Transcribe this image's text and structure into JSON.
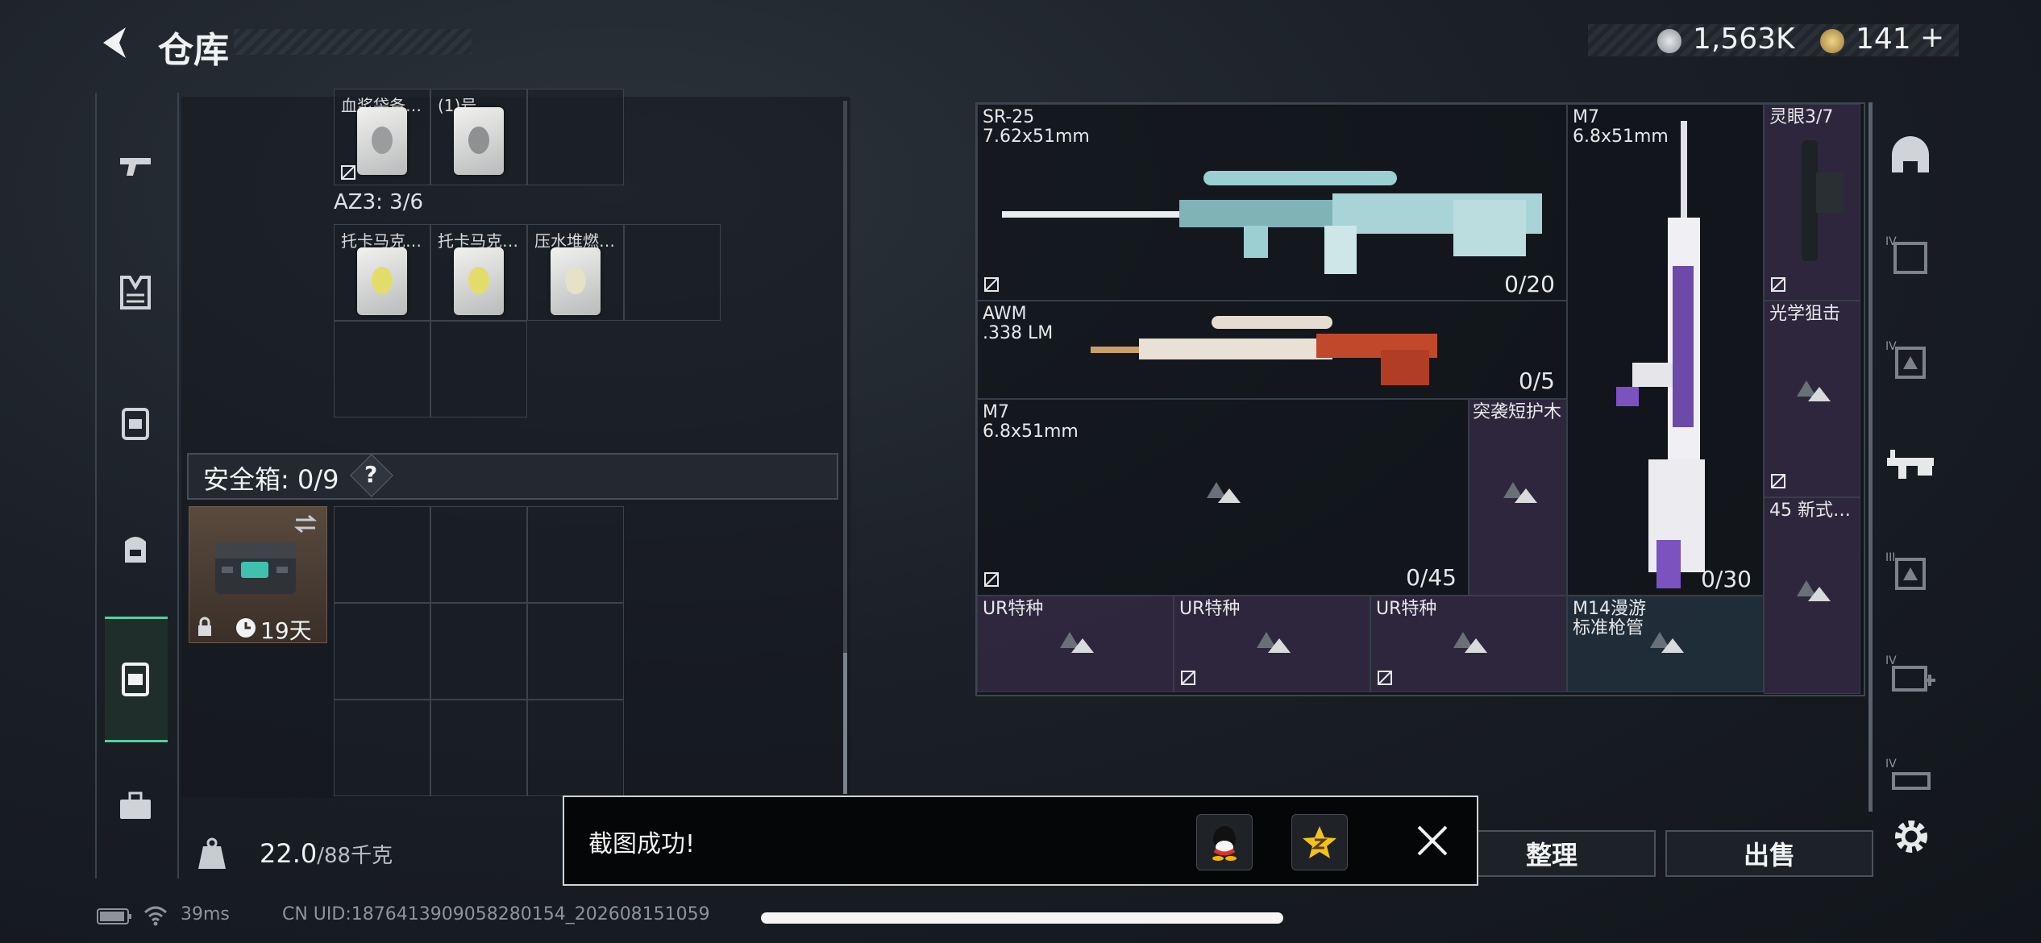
{
  "header": {
    "title": "仓库",
    "currency_primary": "1,563K",
    "currency_secondary": "141",
    "add_symbol": "+",
    "colors": {
      "accent": "#4fd1a4",
      "coin_silver": "#c8ccd0",
      "coin_gold": "#c9a85a"
    }
  },
  "sidebar": {
    "items": [
      {
        "name": "pistol-icon"
      },
      {
        "name": "armor-icon"
      },
      {
        "name": "chest-rig-icon"
      },
      {
        "name": "backpack-icon"
      },
      {
        "name": "secure-container-icon",
        "active": true
      },
      {
        "name": "toolbox-icon"
      }
    ]
  },
  "inventory": {
    "top_items": [
      {
        "label": "血浆袋备…"
      },
      {
        "label": "(1)号…"
      }
    ],
    "az3_label": "AZ3: 3/6",
    "az3_items": [
      {
        "label": "托卡马克…"
      },
      {
        "label": "托卡马克…"
      },
      {
        "label": "压水堆燃…"
      }
    ],
    "safe_box_label": "安全箱: 0/9",
    "safe_box_help": "?",
    "safe_item_days": "19天",
    "weight_value": "22.0",
    "weight_max": "/88千克"
  },
  "weapons": {
    "sr25": {
      "name": "SR-25",
      "caliber": "7.62x51mm",
      "count": "0/20"
    },
    "m7_top": {
      "name": "M7",
      "caliber": "6.8x51mm",
      "count": "0/30"
    },
    "scope_top": {
      "label": "灵眼3/7"
    },
    "awm": {
      "name": "AWM",
      "caliber": ".338 LM",
      "count": "0/5"
    },
    "scope_opt": {
      "label": "光学狙击"
    },
    "m7_mid": {
      "name": "M7",
      "caliber": "6.8x51mm",
      "count": "0/45"
    },
    "handguard": {
      "label": "突袭短护木"
    },
    "side_45": {
      "label": "45 新式…"
    },
    "bottom": [
      {
        "label": "UR特种"
      },
      {
        "label": "UR特种"
      },
      {
        "label": "UR特种"
      },
      {
        "label": "M14漫游\n标准枪管"
      }
    ]
  },
  "right_icons": [
    {
      "name": "helmet-icon"
    },
    {
      "name": "armor-iv-icon",
      "tier": "IV"
    },
    {
      "name": "rig-iv-icon",
      "tier": "IV"
    },
    {
      "name": "rifle-icon"
    },
    {
      "name": "rig-iii-icon",
      "tier": "III"
    },
    {
      "name": "medkit-iv-icon",
      "tier": "IV"
    },
    {
      "name": "vest-iv-icon",
      "tier": "IV"
    }
  ],
  "buttons": {
    "organize": "整理",
    "sell": "出售"
  },
  "toast": {
    "message": "截图成功!"
  },
  "status": {
    "ping": "39ms",
    "uid": "CN UID:1876413909058280154_202608151059"
  }
}
